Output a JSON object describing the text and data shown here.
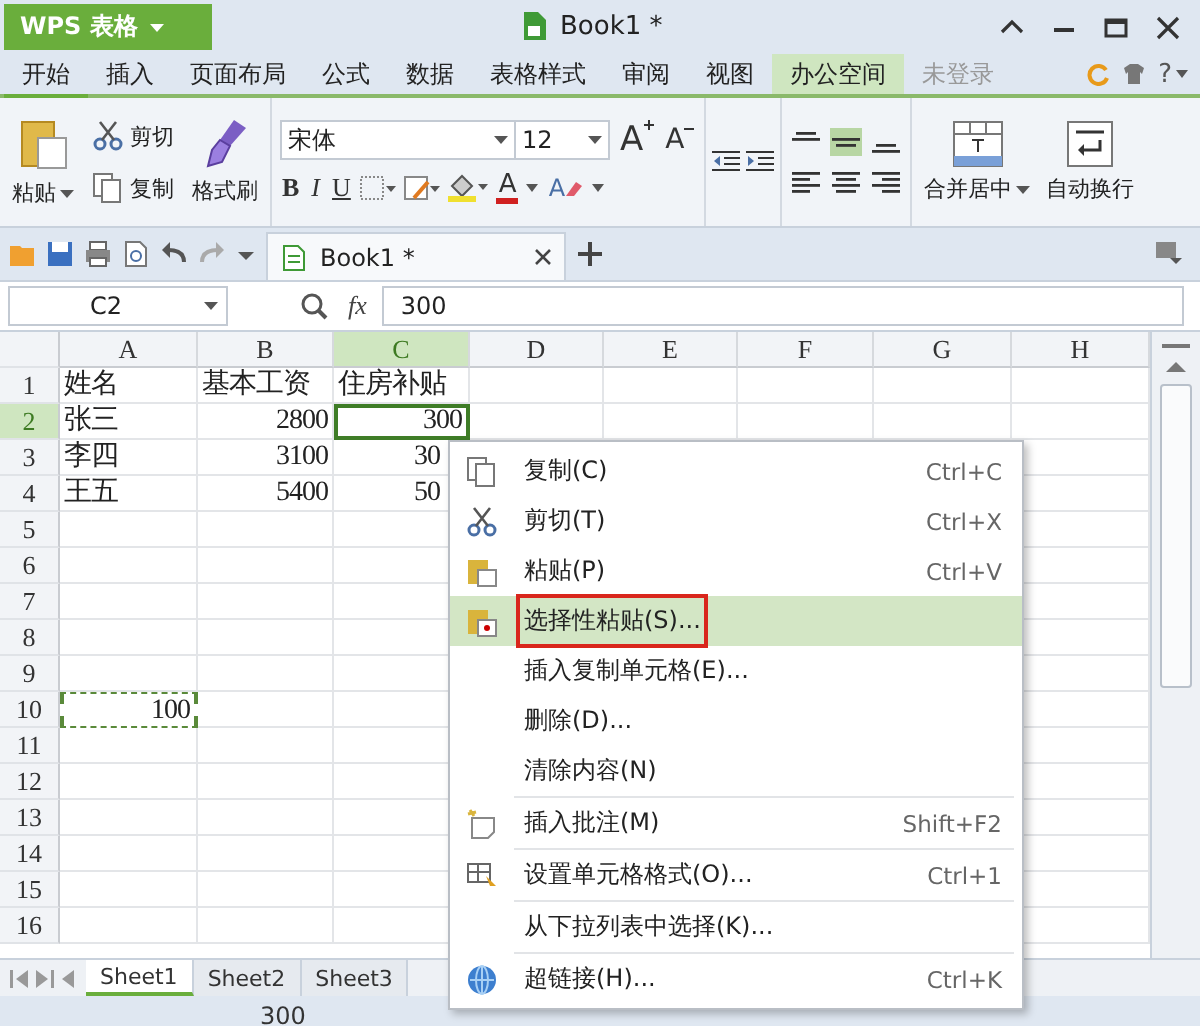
{
  "window": {
    "app_button": "WPS 表格",
    "title": "Book1 *",
    "help": "?"
  },
  "menu_tabs": [
    {
      "label": "开始",
      "selected": true,
      "kind": "tab"
    },
    {
      "label": "插入",
      "selected": false,
      "kind": "tab"
    },
    {
      "label": "页面布局",
      "selected": false,
      "kind": "tab"
    },
    {
      "label": "公式",
      "selected": false,
      "kind": "tab"
    },
    {
      "label": "数据",
      "selected": false,
      "kind": "tab"
    },
    {
      "label": "表格样式",
      "selected": false,
      "kind": "tab"
    },
    {
      "label": "审阅",
      "selected": false,
      "kind": "tab"
    },
    {
      "label": "视图",
      "selected": false,
      "kind": "tab"
    },
    {
      "label": "办公空间",
      "selected": false,
      "kind": "space"
    },
    {
      "label": "未登录",
      "selected": false,
      "kind": "login"
    }
  ],
  "ribbon": {
    "paste": "粘贴",
    "cut": "剪切",
    "copy": "复制",
    "format_painter": "格式刷",
    "font": "宋体",
    "font_size": "12",
    "merge_center": "合并居中",
    "wrap_text": "自动换行",
    "size_buttons": [
      {
        "label": "A",
        "kind": "grow"
      },
      {
        "label": "A",
        "kind": "shrink"
      }
    ],
    "style_buttons": [
      {
        "label": "B",
        "kind": "bold"
      },
      {
        "label": "I",
        "kind": "italic"
      },
      {
        "label": "U",
        "kind": "underline"
      }
    ],
    "color_buttons": [
      {
        "label": "A",
        "kind": "font-color"
      },
      {
        "label": "A",
        "kind": "clear"
      }
    ],
    "vertical_align": [
      {
        "selected": false
      },
      {
        "selected": true
      },
      {
        "selected": false
      }
    ]
  },
  "doc_tab": {
    "label": "Book1 *"
  },
  "formula_bar": {
    "name_box": "C2",
    "fx": "fx",
    "value": "300"
  },
  "columns": [
    {
      "label": "A",
      "selected": false
    },
    {
      "label": "B",
      "selected": false
    },
    {
      "label": "C",
      "selected": true
    },
    {
      "label": "D",
      "selected": false
    },
    {
      "label": "E",
      "selected": false
    },
    {
      "label": "F",
      "selected": false
    },
    {
      "label": "G",
      "selected": false
    },
    {
      "label": "H",
      "selected": false
    }
  ],
  "rows": [
    {
      "header": "1",
      "selected": false,
      "cells": [
        {
          "text": "姓名",
          "kind": "text"
        },
        {
          "text": "基本工资",
          "kind": "text"
        },
        {
          "text": "住房补贴",
          "kind": "text"
        }
      ]
    },
    {
      "header": "2",
      "selected": true,
      "cells": [
        {
          "text": "张三",
          "kind": "text"
        },
        {
          "text": "2800",
          "kind": "number"
        },
        {
          "text": "300",
          "kind": "number",
          "active": true
        }
      ]
    },
    {
      "header": "3",
      "selected": false,
      "cells": [
        {
          "text": "李四",
          "kind": "text"
        },
        {
          "text": "3100",
          "kind": "number"
        },
        {
          "text": "30",
          "kind": "cut"
        }
      ]
    },
    {
      "header": "4",
      "selected": false,
      "cells": [
        {
          "text": "王五",
          "kind": "text"
        },
        {
          "text": "5400",
          "kind": "number"
        },
        {
          "text": "50",
          "kind": "cut"
        }
      ]
    },
    {
      "header": "5",
      "selected": false,
      "cells": []
    },
    {
      "header": "6",
      "selected": false,
      "cells": []
    },
    {
      "header": "7",
      "selected": false,
      "cells": []
    },
    {
      "header": "8",
      "selected": false,
      "cells": []
    },
    {
      "header": "9",
      "selected": false,
      "cells": []
    },
    {
      "header": "10",
      "selected": false,
      "cells": [
        {
          "text": "100",
          "kind": "number",
          "copied": true
        }
      ]
    },
    {
      "header": "11",
      "selected": false,
      "cells": []
    },
    {
      "header": "12",
      "selected": false,
      "cells": []
    },
    {
      "header": "13",
      "selected": false,
      "cells": []
    },
    {
      "header": "14",
      "selected": false,
      "cells": []
    },
    {
      "header": "15",
      "selected": false,
      "cells": []
    },
    {
      "header": "16",
      "selected": false,
      "cells": []
    }
  ],
  "context_menu": [
    {
      "label": "复制(C)",
      "shortcut": "Ctrl+C",
      "kind": "copy",
      "selected": false,
      "separator_before": false
    },
    {
      "label": "剪切(T)",
      "shortcut": "Ctrl+X",
      "kind": "cut",
      "selected": false,
      "separator_before": false
    },
    {
      "label": "粘贴(P)",
      "shortcut": "Ctrl+V",
      "kind": "paste",
      "selected": false,
      "separator_before": false
    },
    {
      "label": "选择性粘贴(S)...",
      "kind": "paste-special",
      "selected": true,
      "outlined": true,
      "separator_before": false
    },
    {
      "label": "插入复制单元格(E)...",
      "kind": "plain",
      "selected": false,
      "separator_before": false
    },
    {
      "label": "删除(D)...",
      "kind": "plain",
      "selected": false,
      "separator_before": false
    },
    {
      "label": "清除内容(N)",
      "kind": "plain",
      "selected": false,
      "separator_before": false
    },
    {
      "label": "插入批注(M)",
      "shortcut": "Shift+F2",
      "kind": "comment",
      "selected": false,
      "separator_before": true
    },
    {
      "label": "设置单元格格式(O)...",
      "shortcut": "Ctrl+1",
      "kind": "format",
      "selected": false,
      "separator_before": true
    },
    {
      "label": "从下拉列表中选择(K)...",
      "kind": "plain",
      "selected": false,
      "separator_before": true
    },
    {
      "label": "超链接(H)...",
      "shortcut": "Ctrl+K",
      "kind": "link",
      "selected": false,
      "separator_before": true
    }
  ],
  "sheet_tabs": [
    {
      "label": "Sheet1",
      "selected": true
    },
    {
      "label": "Sheet2",
      "selected": false
    },
    {
      "label": "Sheet3",
      "selected": false
    }
  ],
  "status_bar": {
    "value": "300"
  }
}
